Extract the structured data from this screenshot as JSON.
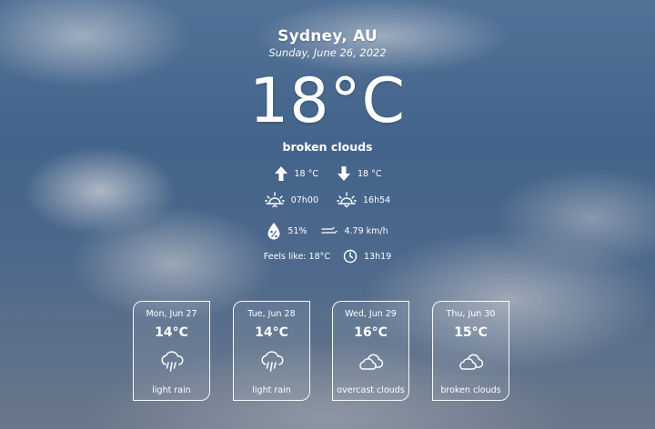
{
  "location": {
    "city": "Sydney, AU",
    "date": "Sunday, June 26, 2022"
  },
  "current": {
    "temperature": "18°C",
    "description": "broken clouds",
    "temp_max": "18 °C",
    "temp_min": "18 °C",
    "sunrise": "07h00",
    "sunset": "16h54",
    "humidity": "51%",
    "wind": "4.79 km/h",
    "feels_like": "Feels like: 18°C",
    "time": "13h19"
  },
  "forecast": [
    {
      "date": "Mon, Jun 27",
      "temp": "14°C",
      "icon": "rain-cloud-icon",
      "description": "light rain"
    },
    {
      "date": "Tue, Jun 28",
      "temp": "14°C",
      "icon": "rain-cloud-icon",
      "description": "light rain"
    },
    {
      "date": "Wed, Jun 29",
      "temp": "16°C",
      "icon": "clouds-icon",
      "description": "overcast clouds"
    },
    {
      "date": "Thu, Jun 30",
      "temp": "15°C",
      "icon": "clouds-icon",
      "description": "broken clouds"
    }
  ]
}
